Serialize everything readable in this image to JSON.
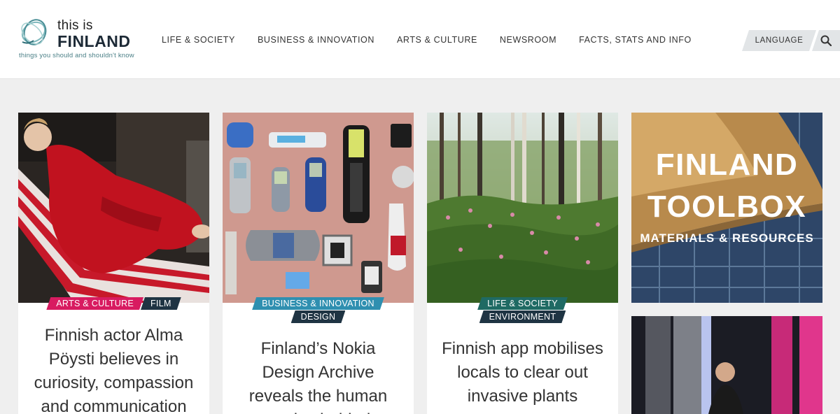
{
  "brand": {
    "logo_small": "this is",
    "logo_large": "FINLAND",
    "tagline": "things you should and shouldn't know"
  },
  "nav": {
    "items": [
      "LIFE & SOCIETY",
      "BUSINESS & INNOVATION",
      "ARTS & CULTURE",
      "NEWSROOM",
      "FACTS, STATS AND INFO"
    ]
  },
  "header": {
    "language_label": "LANGUAGE",
    "search_icon": "search-icon"
  },
  "colors": {
    "arts": "#d81b60",
    "business": "#2f8fb0",
    "life": "#1f6a63",
    "dark_tag": "#1f3443"
  },
  "cards": [
    {
      "tags": [
        "ARTS & CULTURE",
        "FILM"
      ],
      "title": "Finnish actor Alma Pöysti believes in curiosity, compassion and communication"
    },
    {
      "tags": [
        "BUSINESS & INNOVATION",
        "DESIGN"
      ],
      "title": "Finland’s Nokia Design Archive reveals the human stories behind"
    },
    {
      "tags": [
        "LIFE & SOCIETY",
        "ENVIRONMENT"
      ],
      "title": "Finnish app mobilises locals to clear out invasive plants"
    }
  ],
  "toolbox": {
    "line1": "FINLAND",
    "line2": "TOOLBOX",
    "line3": "MATERIALS & RESOURCES"
  }
}
